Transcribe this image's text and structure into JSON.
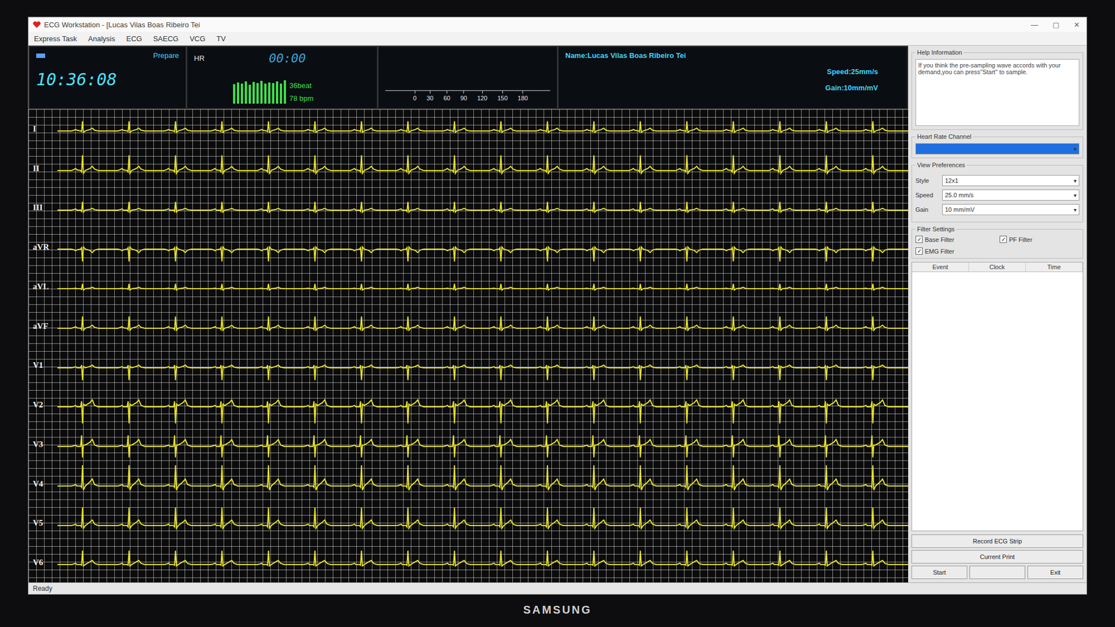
{
  "window": {
    "title": "ECG Workstation - [Lucas Vilas Boas Ribeiro Tei",
    "controls": [
      "—",
      "▢",
      "✕"
    ]
  },
  "menu": [
    "Express Task",
    "Analysis",
    "ECG",
    "SAECG",
    "VCG",
    "TV"
  ],
  "status_panel": {
    "state": "Prepare",
    "clock": "10:36:08"
  },
  "hr_panel": {
    "label": "HR",
    "timer": "00:00",
    "beats": "36beat",
    "rate": "78 bpm",
    "bars": [
      0.72,
      0.8,
      0.76,
      0.84,
      0.7,
      0.82,
      0.78,
      0.86,
      0.74,
      0.8,
      0.77,
      0.83,
      0.75,
      0.88
    ]
  },
  "scale_panel": {
    "ticks": [
      "0",
      "30",
      "60",
      "90",
      "120",
      "150",
      "180"
    ]
  },
  "info_panel": {
    "name": "Name:Lucas Vilas Boas Ribeiro Tei",
    "speed": "Speed:25mm/s",
    "gain": "Gain:10mm/mV"
  },
  "ecg": {
    "beats_shown": 18,
    "sample_times": [
      0,
      0.06,
      0.09,
      0.12,
      0.2,
      0.22,
      0.24,
      0.26,
      0.3,
      0.4,
      0.45,
      0.5,
      0.58
    ],
    "leads": [
      {
        "name": "I",
        "values": [
          0,
          0.05,
          0.1,
          0.05,
          0,
          -0.05,
          0.7,
          -0.1,
          0,
          0.1,
          0.2,
          0.05,
          0
        ]
      },
      {
        "name": "II",
        "values": [
          0,
          0.08,
          0.15,
          0.05,
          0,
          -0.1,
          1.1,
          -0.2,
          0,
          0.15,
          0.3,
          0.1,
          0
        ]
      },
      {
        "name": "III",
        "values": [
          0,
          0.05,
          0.08,
          0,
          0,
          -0.1,
          0.6,
          -0.15,
          0,
          0.05,
          0.12,
          0.03,
          0
        ]
      },
      {
        "name": "aVR",
        "values": [
          0,
          -0.05,
          -0.12,
          -0.05,
          0,
          0.1,
          -0.9,
          0.15,
          0,
          -0.1,
          -0.25,
          -0.08,
          0
        ]
      },
      {
        "name": "aVL",
        "values": [
          0,
          0.02,
          0.04,
          0,
          0,
          -0.05,
          0.35,
          -0.1,
          0,
          0.04,
          0.1,
          0.02,
          0
        ]
      },
      {
        "name": "aVF",
        "values": [
          0,
          0.06,
          0.12,
          0.03,
          0,
          -0.1,
          0.85,
          -0.15,
          0,
          0.1,
          0.22,
          0.06,
          0
        ]
      },
      {
        "name": "V1",
        "values": [
          0,
          0.04,
          0.08,
          0,
          0,
          0.2,
          -0.9,
          0.1,
          0,
          0.1,
          0.2,
          0.05,
          0
        ]
      },
      {
        "name": "V2",
        "values": [
          0,
          0.05,
          0.1,
          0,
          0,
          0.4,
          -1.2,
          0.2,
          0.1,
          0.3,
          0.5,
          0.1,
          0
        ]
      },
      {
        "name": "V3",
        "values": [
          0,
          0.05,
          0.1,
          0,
          0,
          0.8,
          -0.8,
          0.1,
          0.1,
          0.3,
          0.5,
          0.1,
          0
        ]
      },
      {
        "name": "V4",
        "values": [
          0,
          0.05,
          0.1,
          0,
          0,
          -0.1,
          1.5,
          -0.3,
          0,
          0.3,
          0.5,
          0.1,
          0
        ]
      },
      {
        "name": "V5",
        "values": [
          0,
          0.05,
          0.1,
          0,
          0,
          -0.1,
          1.3,
          -0.2,
          0,
          0.25,
          0.4,
          0.1,
          0
        ]
      },
      {
        "name": "V6",
        "values": [
          0,
          0.05,
          0.1,
          0,
          0,
          -0.05,
          1.0,
          -0.1,
          0,
          0.2,
          0.3,
          0.08,
          0
        ]
      }
    ]
  },
  "help": {
    "title": "Help Information",
    "text": "If you think the pre-sampling wave accords with your demand,you can press\"Start\" to sample."
  },
  "heart_rate_channel": {
    "title": "Heart Rate Channel",
    "value": "",
    "selected": true
  },
  "view_preferences": {
    "title": "View Preferences",
    "fields": [
      {
        "label": "Style",
        "value": "12x1"
      },
      {
        "label": "Speed",
        "value": "25.0 mm/s"
      },
      {
        "label": "Gain",
        "value": "10 mm/mV"
      }
    ]
  },
  "filter_settings": {
    "title": "Filter Settings",
    "filters": [
      {
        "label": "Base Filter",
        "checked": true
      },
      {
        "label": "PF Filter",
        "checked": true
      },
      {
        "label": "EMG Filter",
        "checked": true
      }
    ]
  },
  "events_table": {
    "columns": [
      "Event",
      "Clock",
      "Time"
    ],
    "rows": []
  },
  "actions": [
    {
      "label": "Record ECG Strip",
      "disabled": false
    },
    {
      "label": "Current Print",
      "disabled": false
    }
  ],
  "buttons": [
    {
      "label": "Start",
      "disabled": false
    },
    {
      "label": "",
      "disabled": true
    },
    {
      "label": "Exit",
      "disabled": false
    }
  ],
  "status_bar": "Ready",
  "monitor": {
    "brand": "SAMSUNG"
  }
}
